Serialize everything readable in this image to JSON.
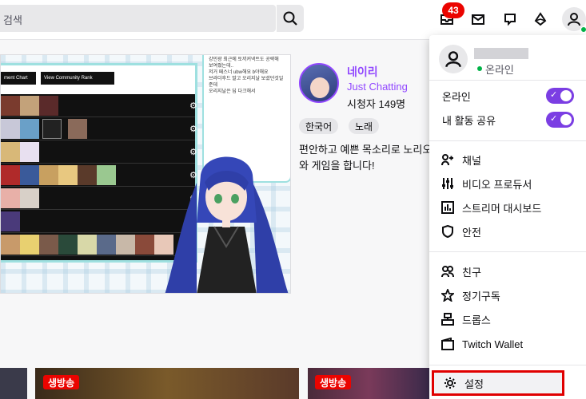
{
  "search": {
    "placeholder": "검색"
  },
  "topbar": {
    "notification_count": "43"
  },
  "stream": {
    "streamer_name": "네이리",
    "category": "Just Chatting",
    "viewers": "시청자 149명",
    "tags": [
      "한국어",
      "노래"
    ],
    "description": "편안하고 예쁜 목소리로 노리오와 게임을 합니다!",
    "tier_buttons": [
      "ment Chart",
      "View Community Rank"
    ],
    "chat_lines": [
      "강민광 최근에 토끼커넥트도 공략해",
      "보여줬는데..",
      "저거 페스너 ubw해요 b야해요",
      "브라더후드 말고 오리지날 보셨던것일",
      "준데",
      "오리지날은 딥 다크해서"
    ]
  },
  "bottom": {
    "live_label_1": "생방송",
    "live_label_2": "생방송"
  },
  "menu": {
    "status": "온라인",
    "online_toggle_label": "온라인",
    "share_activity_label": "내 활동 공유",
    "items": [
      {
        "label": "채널",
        "icon": "channel-icon"
      },
      {
        "label": "비디오 프로듀서",
        "icon": "video-producer-icon"
      },
      {
        "label": "스트리머 대시보드",
        "icon": "dashboard-icon"
      },
      {
        "label": "안전",
        "icon": "shield-icon"
      },
      {
        "label": "친구",
        "icon": "friends-icon"
      },
      {
        "label": "정기구독",
        "icon": "star-icon"
      },
      {
        "label": "드롭스",
        "icon": "drops-icon"
      },
      {
        "label": "Twitch Wallet",
        "icon": "wallet-icon"
      },
      {
        "label": "설정",
        "icon": "gear-icon"
      }
    ]
  },
  "colors": {
    "accent": "#9147ff",
    "live": "#eb0400",
    "highlight_border": "#e00000"
  }
}
